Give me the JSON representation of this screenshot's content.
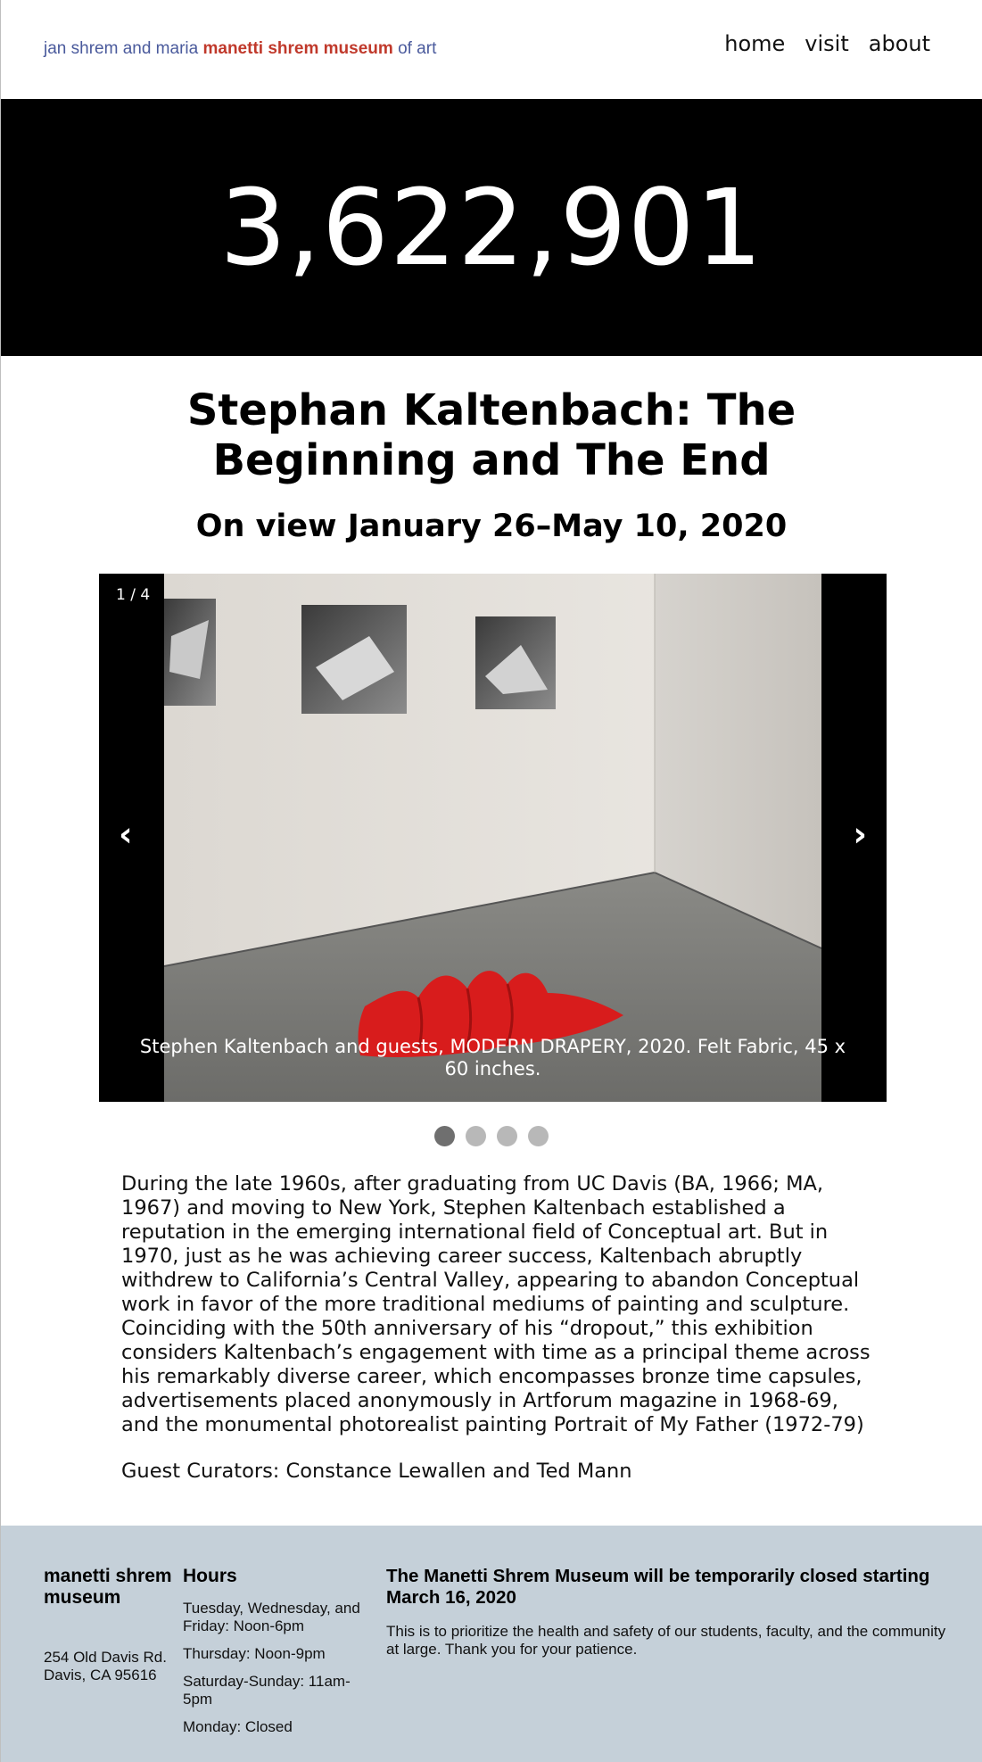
{
  "header": {
    "logo_prefix": "jan shrem and maria",
    "logo_brand": "manetti shrem museum",
    "logo_suffix": "of art",
    "nav": [
      "home",
      "visit",
      "about"
    ]
  },
  "counter": "3,622,901",
  "exhibition": {
    "title": "Stephan Kaltenbach: The Beginning and The End",
    "dates": "On view January 26–May 10, 2020"
  },
  "slideshow": {
    "counter": "1 / 4",
    "prev_icon": "‹",
    "next_icon": "›",
    "caption": "Stephen Kaltenbach and guests, MODERN DRAPERY, 2020. Felt Fabric, 45 x 60 inches.",
    "total_slides": 4,
    "active_slide": 1
  },
  "description": "During the late 1960s, after graduating from UC Davis (BA, 1966; MA, 1967) and moving to New York, Stephen Kaltenbach established a reputation in the emerging international field of Conceptual art. But in 1970, just as he was achieving career success, Kaltenbach abruptly withdrew to California’s Central Valley, appearing to abandon Conceptual work in favor of the more traditional mediums of painting and sculpture. Coinciding with the 50th anniversary of his “dropout,” this exhibition considers Kaltenbach’s engagement with time as a principal theme across his remarkably diverse career, which encompasses bronze time capsules, advertisements placed anonymously in Artforum magazine in 1968-69, and the monumental photorealist painting Portrait of My Father (1972-79)",
  "curators": "Guest Curators: Constance Lewallen and Ted Mann",
  "footer": {
    "brand": "manetti shrem museum",
    "address_line1": "254 Old Davis Rd.",
    "address_line2": "Davis, CA 95616",
    "hours_title": "Hours",
    "hours": [
      "Tuesday, Wednesday, and Friday: Noon-6pm",
      "Thursday: Noon-9pm",
      "Saturday-Sunday: 11am-5pm",
      "Monday: Closed"
    ],
    "notice_title": "The Manetti Shrem Museum will be temporarily closed starting March 16, 2020",
    "notice_text": "This is to prioritize the health and safety of our students, faculty, and the community at large. Thank you for your patience."
  },
  "colors": {
    "brand_red": "#c0392b",
    "logo_blue": "#4a5a9c",
    "footer_bg": "#c5d0d9"
  }
}
